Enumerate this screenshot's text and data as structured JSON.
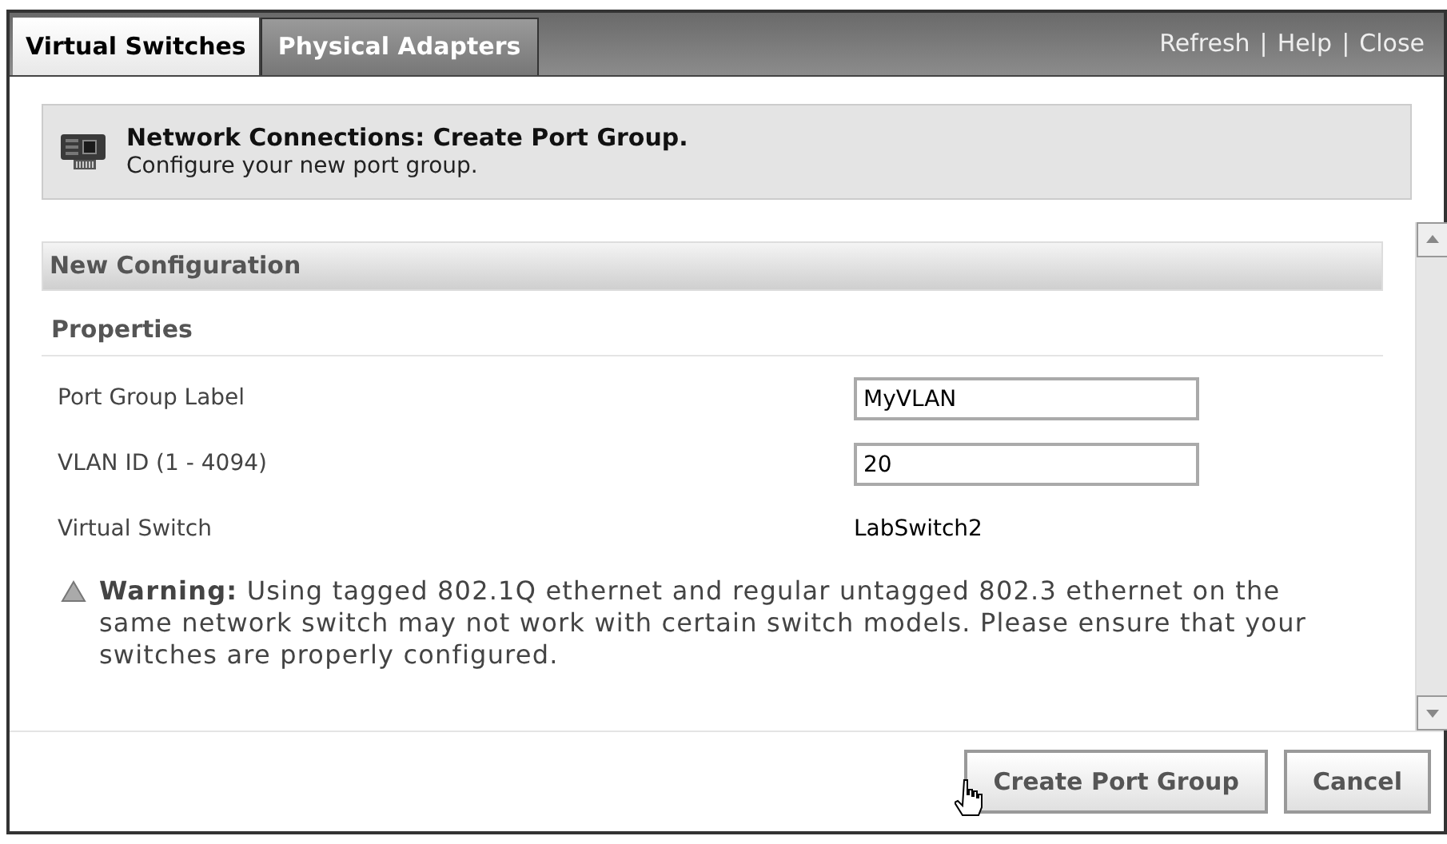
{
  "tabs": [
    {
      "label": "Virtual Switches",
      "selected": true
    },
    {
      "label": "Physical Adapters",
      "selected": false
    }
  ],
  "links": [
    "Refresh",
    "Help",
    "Close"
  ],
  "link_separator": "|",
  "header": {
    "title": "Network Connections: Create Port Group.",
    "subtitle": "Configure your new port group."
  },
  "section_title": "New Configuration",
  "subsection_title": "Properties",
  "fields": [
    {
      "kind": "input",
      "label": "Port Group Label",
      "value": "MyVLAN"
    },
    {
      "kind": "input",
      "label": "VLAN ID (1 - 4094)",
      "value": "20"
    },
    {
      "kind": "text",
      "label": "Virtual Switch",
      "value": "LabSwitch2"
    }
  ],
  "warning": "**Warning:** Using tagged 802.1Q ethernet and regular untagged 802.3 ethernet on the same network switch may not work with certain switch models. Please ensure that your switches are properly configured.",
  "buttons": [
    "Create Port Group",
    "Cancel"
  ]
}
